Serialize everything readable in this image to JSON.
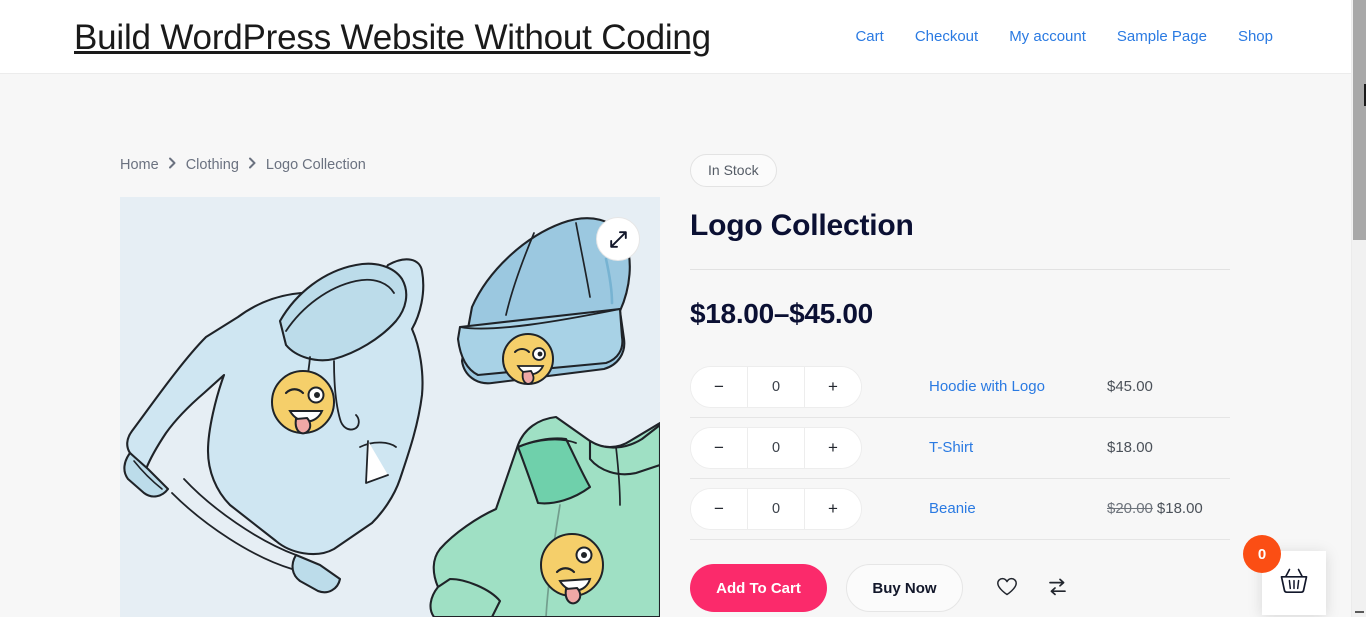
{
  "header": {
    "site_title": "Build WordPress Website Without Coding",
    "nav": [
      {
        "label": "Cart"
      },
      {
        "label": "Checkout"
      },
      {
        "label": "My account"
      },
      {
        "label": "Sample Page"
      },
      {
        "label": "Shop"
      }
    ],
    "link_color": "#2a7ae2"
  },
  "breadcrumb": {
    "items": [
      {
        "label": "Home"
      },
      {
        "label": "Clothing"
      },
      {
        "label": "Logo Collection"
      }
    ],
    "separator": "›"
  },
  "gallery": {
    "zoom_icon": "expand-arrows-icon",
    "background_color": "#e6eef4",
    "alt_items": [
      "hoodie",
      "beanie",
      "t-shirt"
    ]
  },
  "product": {
    "stock_status": "In Stock",
    "title": "Logo Collection",
    "price_range": "$18.00–$45.00",
    "variations": [
      {
        "name": "Hoodie with Logo",
        "quantity": "0",
        "price": "$45.00",
        "was_price": "",
        "decrement_label": "−",
        "increment_label": "+"
      },
      {
        "name": "T-Shirt",
        "quantity": "0",
        "price": "$18.00",
        "was_price": "",
        "decrement_label": "−",
        "increment_label": "+"
      },
      {
        "name": "Beanie",
        "quantity": "0",
        "price": "$18.00",
        "was_price": "$20.00",
        "decrement_label": "−",
        "increment_label": "+"
      }
    ]
  },
  "actions": {
    "add_to_cart_label": "Add To Cart",
    "buy_now_label": "Buy Now",
    "wishlist_icon": "heart-icon",
    "compare_icon": "compare-arrows-icon",
    "accent_color": "#fb2a6b"
  },
  "cart_fab": {
    "count": "0",
    "icon": "shopping-basket-icon",
    "badge_color": "#fb4e14"
  }
}
